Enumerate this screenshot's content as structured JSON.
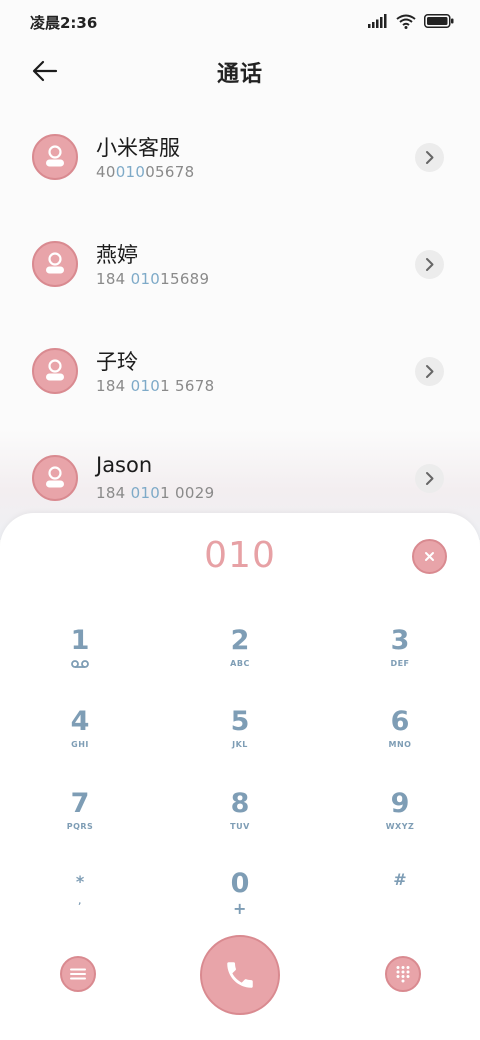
{
  "status_bar": {
    "time": "凌晨2:36"
  },
  "header": {
    "title": "通话"
  },
  "contacts": [
    {
      "name": "小米客服",
      "num_pre": "40",
      "num_hl": "010",
      "num_post": "05678"
    },
    {
      "name": "燕婷",
      "num_pre": "184 ",
      "num_hl": "010",
      "num_post": "15689"
    },
    {
      "name": "子玲",
      "num_pre": "184 ",
      "num_hl": "010",
      "num_post": "1 5678"
    },
    {
      "name": "Jason",
      "num_pre": "184 ",
      "num_hl": "010",
      "num_post": "1 0029"
    }
  ],
  "dialpad": {
    "input": "010",
    "keys": [
      {
        "digit": "1",
        "letters": ""
      },
      {
        "digit": "2",
        "letters": "ABC"
      },
      {
        "digit": "3",
        "letters": "DEF"
      },
      {
        "digit": "4",
        "letters": "GHI"
      },
      {
        "digit": "5",
        "letters": "JKL"
      },
      {
        "digit": "6",
        "letters": "MNO"
      },
      {
        "digit": "7",
        "letters": "PQRS"
      },
      {
        "digit": "8",
        "letters": "TUV"
      },
      {
        "digit": "9",
        "letters": "WXYZ"
      },
      {
        "digit": "*",
        "letters": ","
      },
      {
        "digit": "0",
        "letters": "+"
      },
      {
        "digit": "#",
        "letters": ""
      }
    ]
  },
  "icons": {
    "back": "arrow-left-icon",
    "contact_avatar": "person-icon",
    "detail": "chevron-right-icon",
    "clear": "close-icon",
    "voicemail": "voicemail-icon",
    "menu": "menu-icon",
    "call": "phone-icon",
    "keypad": "keypad-grid-icon"
  },
  "colors": {
    "accent_pink": "#e8a4a9",
    "accent_blue": "#7e9db5",
    "highlight": "#7eaac8"
  }
}
